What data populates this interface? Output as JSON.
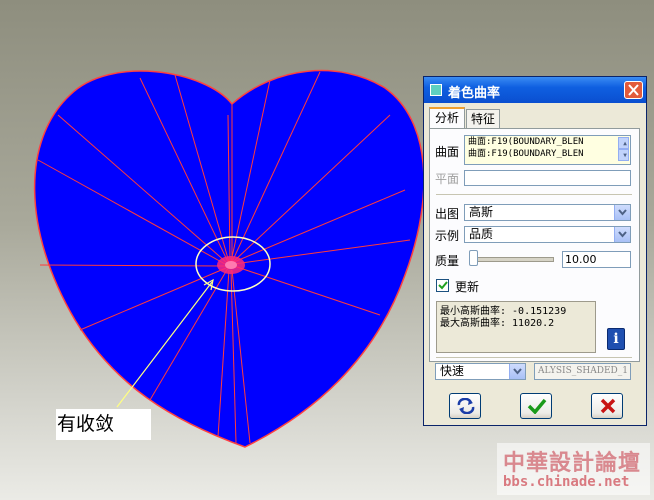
{
  "annotation": {
    "text": "有收敛"
  },
  "dialog": {
    "title": "着色曲率",
    "tabs": [
      {
        "label": "分析"
      },
      {
        "label": "特征"
      }
    ],
    "surface": {
      "label": "曲面",
      "items": [
        "曲面:F19(BOUNDARY_BLEN",
        "曲面:F19(BOUNDARY_BLEN"
      ]
    },
    "plane": {
      "label": "平面",
      "value": ""
    },
    "plot": {
      "label": "出图",
      "value": "高斯"
    },
    "example": {
      "label": "示例",
      "value": "品质"
    },
    "quality": {
      "label": "质量",
      "value": "10.00",
      "slider_fraction": 0.0
    },
    "update": {
      "label": "更新",
      "checked": true
    },
    "results": {
      "min": "最小高斯曲率: -0.151239",
      "max": "最大高斯曲率: 11020.2"
    },
    "info_glyph": "i",
    "mode": {
      "value": "快速"
    },
    "result_name": "ALYSIS_SHADED_1",
    "buttons": {
      "refresh_icon": "refresh-icon",
      "ok_icon": "check-icon",
      "cancel_icon": "cancel-x-icon"
    }
  },
  "watermark": {
    "title": "中華設計論壇",
    "url": "bbs.chinade.net"
  },
  "colors": {
    "surface": "#0000ff",
    "curves": "#ff3b3b",
    "accent": "#0a4fd0"
  }
}
